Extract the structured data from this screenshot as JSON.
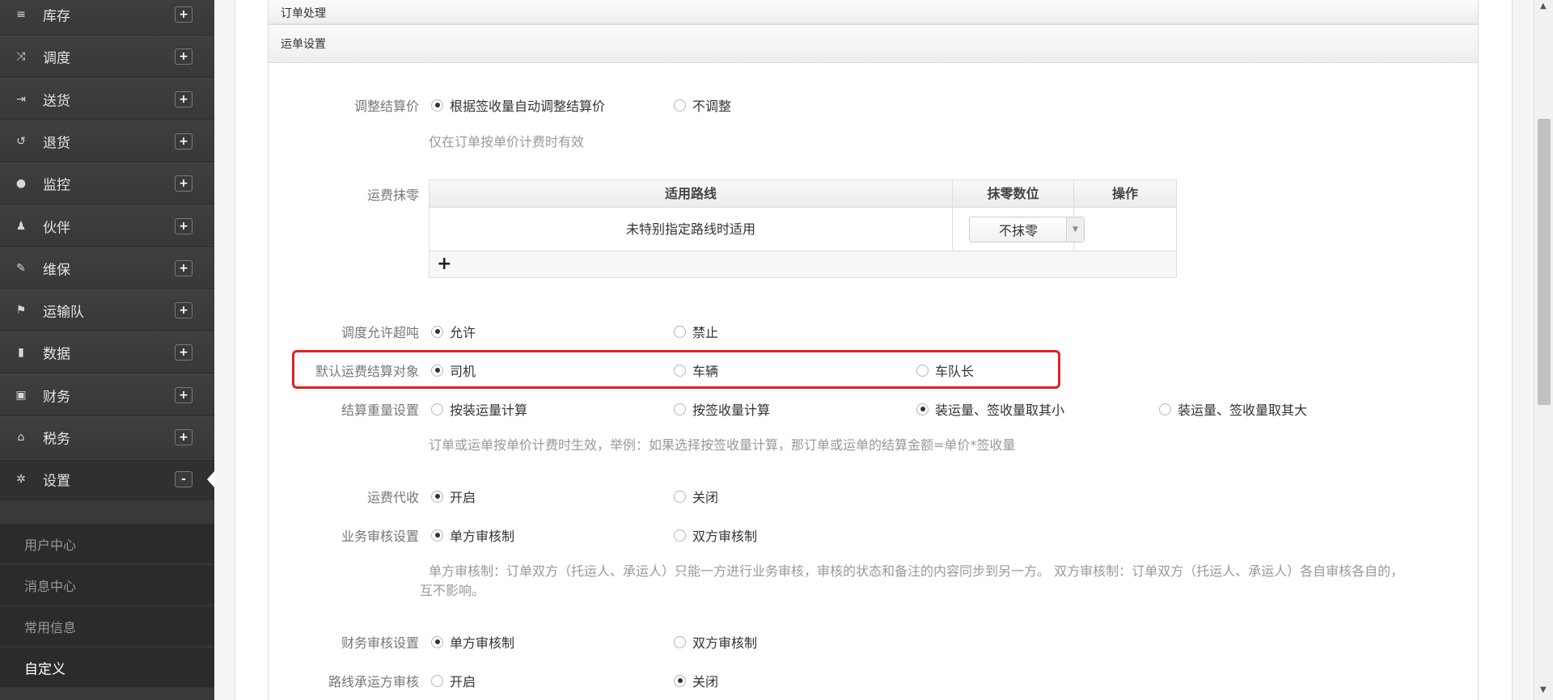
{
  "sidebar": {
    "items": [
      {
        "label": "库存",
        "icon": "layers-icon",
        "glyph": "≡",
        "toggle": "+"
      },
      {
        "label": "调度",
        "icon": "shuffle-icon",
        "glyph": "⤨",
        "toggle": "+"
      },
      {
        "label": "送货",
        "icon": "sign-out-icon",
        "glyph": "⇥",
        "toggle": "+"
      },
      {
        "label": "退货",
        "icon": "undo-icon",
        "glyph": "↺",
        "toggle": "+"
      },
      {
        "label": "监控",
        "icon": "map-marker-icon",
        "glyph": "●",
        "toggle": "+"
      },
      {
        "label": "伙伴",
        "icon": "user-icon",
        "glyph": "♟",
        "toggle": "+"
      },
      {
        "label": "维保",
        "icon": "wrench-icon",
        "glyph": "✎",
        "toggle": "+"
      },
      {
        "label": "运输队",
        "icon": "flag-icon",
        "glyph": "⚑",
        "toggle": "+"
      },
      {
        "label": "数据",
        "icon": "signal-icon",
        "glyph": "▮",
        "toggle": "+"
      },
      {
        "label": "财务",
        "icon": "briefcase-icon",
        "glyph": "▣",
        "toggle": "+"
      },
      {
        "label": "税务",
        "icon": "bank-icon",
        "glyph": "⌂",
        "toggle": "+"
      },
      {
        "label": "设置",
        "icon": "gear-icon",
        "glyph": "✲",
        "toggle": "-"
      }
    ],
    "sub_items": [
      "用户中心",
      "消息中心",
      "常用信息",
      "自定义"
    ],
    "current_sub": "自定义"
  },
  "sections": {
    "order_processing": "订单处理",
    "waybill_settings": "运单设置"
  },
  "form": {
    "adjust_price": {
      "label": "调整结算价",
      "options": [
        "根据签收量自动调整结算价",
        "不调整"
      ],
      "selected": 0,
      "hint": "仅在订单按单价计费时有效"
    },
    "freight_zero": {
      "label": "运费抹零",
      "headers": [
        "适用路线",
        "抹零数位",
        "操作"
      ],
      "row": {
        "route": "未特别指定路线时适用",
        "digit": "不抹零"
      },
      "add": "+"
    },
    "dispatch_overweight": {
      "label": "调度允许超吨",
      "options": [
        "允许",
        "禁止"
      ],
      "selected": 0
    },
    "default_settle_target": {
      "label": "默认运费结算对象",
      "options": [
        "司机",
        "车辆",
        "车队长"
      ],
      "selected": 0
    },
    "settle_weight": {
      "label": "结算重量设置",
      "options": [
        "按装运量计算",
        "按签收量计算",
        "装运量、签收量取其小",
        "装运量、签收量取其大"
      ],
      "selected": 2,
      "hint": "订单或运单按单价计费时生效，举例：如果选择按签收量计算，那订单或运单的结算金额=单价*签收量"
    },
    "freight_collect": {
      "label": "运费代收",
      "options": [
        "开启",
        "关闭"
      ],
      "selected": 0
    },
    "business_audit": {
      "label": "业务审核设置",
      "options": [
        "单方审核制",
        "双方审核制"
      ],
      "selected": 0,
      "hint_line1": "单方审核制：订单双方（托运人、承运人）只能一方进行业务审核，审核的状态和备注的内容同步到另一方。 双方审核制：订单双方（托运人、承运人）各自审核各自的，",
      "hint_line2": "互不影响。"
    },
    "finance_audit": {
      "label": "财务审核设置",
      "options": [
        "单方审核制",
        "双方审核制"
      ],
      "selected": 0
    },
    "route_carrier_audit": {
      "label": "路线承运方审核",
      "options": [
        "开启",
        "关闭"
      ],
      "selected": 1
    }
  },
  "colors": {
    "sidebar_bg": "#393939",
    "highlight": "#e3211e"
  }
}
